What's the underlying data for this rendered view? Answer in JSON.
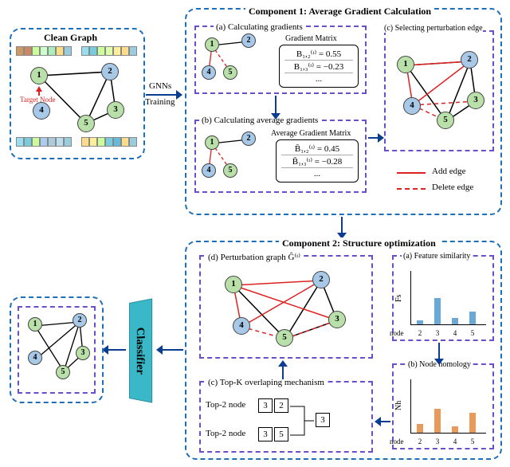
{
  "clean_graph": {
    "title": "Clean Graph",
    "target_label": "Target Node"
  },
  "gnn_arrow": {
    "top": "GNNs",
    "bottom": "Training"
  },
  "comp1": {
    "title": "Component 1: Average Gradient Calculation",
    "a_label": "(a) Calculating gradients",
    "b_label": "(b) Calculating average gradients",
    "c_label": "(c) Selecting perturbation edge",
    "grad_title": "Gradient Matrix",
    "grad_rows": [
      "B₁,₂⁽ᵗ⁾ = 0.55",
      "B₁,₃⁽ᵗ⁾ = −0.23",
      "..."
    ],
    "avg_grad_title": "Average Gradient Matrix",
    "avg_grad_rows": [
      "B̄₁,₂⁽ᵗ⁾ = 0.45",
      "B̄₁,₃⁽ᵗ⁾ = −0.28",
      "..."
    ],
    "legend_add": "Add edge",
    "legend_del": "Delete edge"
  },
  "comp2": {
    "title": "Component 2: Structure optimization",
    "d_label": "(d)  Perturbation graph Ĝ⁽ᵗ⁾",
    "a_label": "(a) Feature similarity",
    "b_label": "(b) Node homology",
    "c_label": "(c) Top-K overlaping mechanism",
    "top2a": "Top-2 node",
    "top2b": "Top-2 node",
    "topk_a": [
      "3",
      "2"
    ],
    "topk_b": [
      "3",
      "5"
    ],
    "topk_out": [
      "3"
    ]
  },
  "classifier_label": "Classifier",
  "chart_data": [
    {
      "type": "bar",
      "title": "(a) Feature similarity",
      "categories": [
        "2",
        "3",
        "4",
        "5"
      ],
      "values": [
        0.1,
        0.6,
        0.15,
        0.3
      ],
      "xlabel": "node",
      "ylabel": "Fs",
      "ylim": [
        0,
        1
      ],
      "color": "#6aa8d8"
    },
    {
      "type": "bar",
      "title": "(b) Node homology",
      "categories": [
        "2",
        "3",
        "4",
        "5"
      ],
      "values": [
        0.2,
        0.55,
        0.15,
        0.45
      ],
      "xlabel": "node",
      "ylabel": "Nh",
      "ylim": [
        0,
        1
      ],
      "color": "#e89a5a"
    }
  ],
  "nodes": [
    "1",
    "2",
    "3",
    "4",
    "5"
  ]
}
